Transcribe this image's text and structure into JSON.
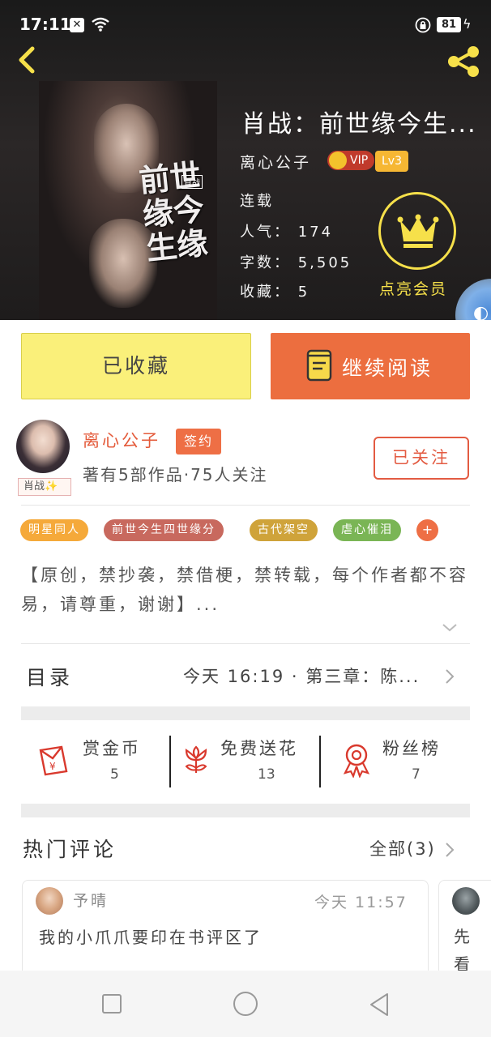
{
  "status_bar": {
    "time": "17:11",
    "battery": "81"
  },
  "book": {
    "title": "肖战：前世缘今生...",
    "cover_text": "前世缘今生缘",
    "cover_stamp": "肖战",
    "author": "离心公子",
    "vip_badge": "VIP",
    "level": "Lv3",
    "status": "连载",
    "popularity": "人气： 174",
    "word_count": "字数： 5,505",
    "favorites": "收藏： 5",
    "vip_cta": "点亮会员"
  },
  "actions": {
    "favorited": "已收藏",
    "continue_reading": "继续阅读"
  },
  "author": {
    "name": "离心公子",
    "signed": "签约",
    "avatar_tag": "肖战✨",
    "info": "著有5部作品·75人关注",
    "follow": "已关注"
  },
  "tags": [
    {
      "label": "明星同人",
      "color": "#f5a93a"
    },
    {
      "label": "前世今生四世缘分",
      "color": "#c8695e"
    },
    {
      "label": "古代架空",
      "color": "#cfa33a"
    },
    {
      "label": "虐心催泪",
      "color": "#7ab555"
    }
  ],
  "tag_more": "+",
  "description": "【原创，禁抄袭，禁借梗，禁转载，每个作者都不容易，请尊重，谢谢】...",
  "catalog": {
    "label": "目录",
    "latest": "今天 16:19 · 第三章：陈..."
  },
  "gifts": [
    {
      "name": "赏金币",
      "value": "5",
      "icon": "red-envelope-icon"
    },
    {
      "name": "免费送花",
      "value": "13",
      "icon": "flower-icon"
    },
    {
      "name": "粉丝榜",
      "value": "7",
      "icon": "medal-icon"
    }
  ],
  "comments": {
    "title": "热门评论",
    "all": "全部(3)",
    "items": [
      {
        "user": "予晴",
        "time": "今天 11:57",
        "text": "我的小爪爪要印在书评区了"
      },
      {
        "text": "先看"
      }
    ]
  },
  "colors": {
    "accent": "#ec6e3f",
    "favorite_bg": "#faf07a",
    "vip_gold": "#f6e04a"
  }
}
